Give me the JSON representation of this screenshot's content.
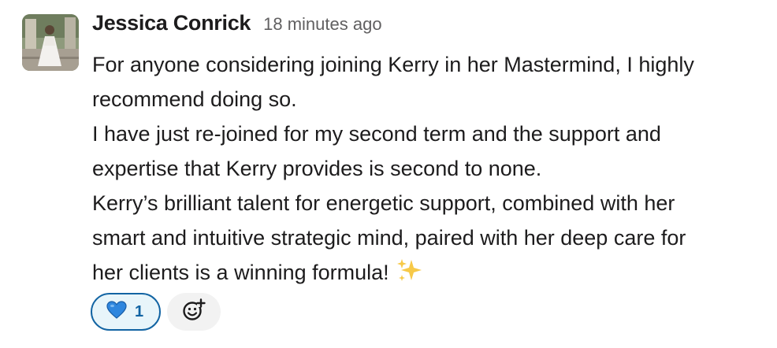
{
  "message": {
    "author": "Jessica Conrick",
    "timestamp": "18 minutes ago",
    "lines": [
      "For anyone considering joining Kerry in her Mastermind, I highly",
      "recommend doing so.",
      "I have just re-joined for my second term and the support and",
      "expertise that Kerry provides is second to none.",
      "Kerry’s brilliant talent for energetic support, combined with her",
      "smart and intuitive strategic mind, paired with her deep care for",
      "her clients is a winning formula!"
    ],
    "trailing_emoji": "sparkles-icon"
  },
  "reactions": [
    {
      "icon": "blue-heart-icon",
      "count": "1",
      "selected": true
    }
  ],
  "add_reaction": {
    "icon": "add-reaction-icon"
  },
  "colors": {
    "text": "#1d1c1d",
    "timestamp": "#616061",
    "reaction_border": "#1264a3",
    "reaction_bg": "#e8f5fa",
    "heart": "#2e86de",
    "sparkles": "#f7c948"
  }
}
